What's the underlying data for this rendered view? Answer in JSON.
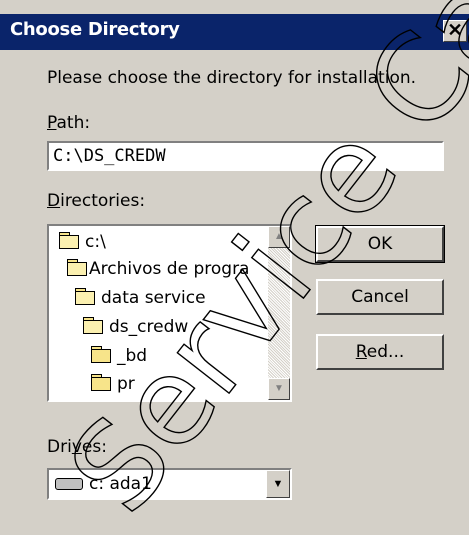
{
  "dialog": {
    "title": "Choose Directory",
    "close_glyph": "✕",
    "instruction": "Please choose the directory for installation.",
    "path_label_u": "P",
    "path_label_rest": "ath:",
    "path_value": "C:\\DS_CREDW",
    "directories_label_u": "D",
    "directories_label_rest": "irectories:",
    "directories": [
      {
        "label": "c:\\",
        "icon": "open-folder-icon"
      },
      {
        "label": "Archivos de progra",
        "icon": "open-folder-icon"
      },
      {
        "label": "data service",
        "icon": "open-folder-icon"
      },
      {
        "label": "ds_credw",
        "icon": "open-folder-icon"
      },
      {
        "label": "_bd",
        "icon": "folder-icon"
      },
      {
        "label": "pr",
        "icon": "folder-icon"
      }
    ],
    "buttons": {
      "ok": "OK",
      "cancel": "Cancel",
      "red_u": "R",
      "red_rest": "ed..."
    },
    "drives_label_pre": "Dri",
    "drives_label_u": "v",
    "drives_label_rest": "es:",
    "drive_value": "c: ada1",
    "watermark_text": "Service Capacity"
  },
  "colors": {
    "titlebar": "#0a246a",
    "dialog_bg": "#d4d0c8",
    "folder": "#f7e48a"
  }
}
